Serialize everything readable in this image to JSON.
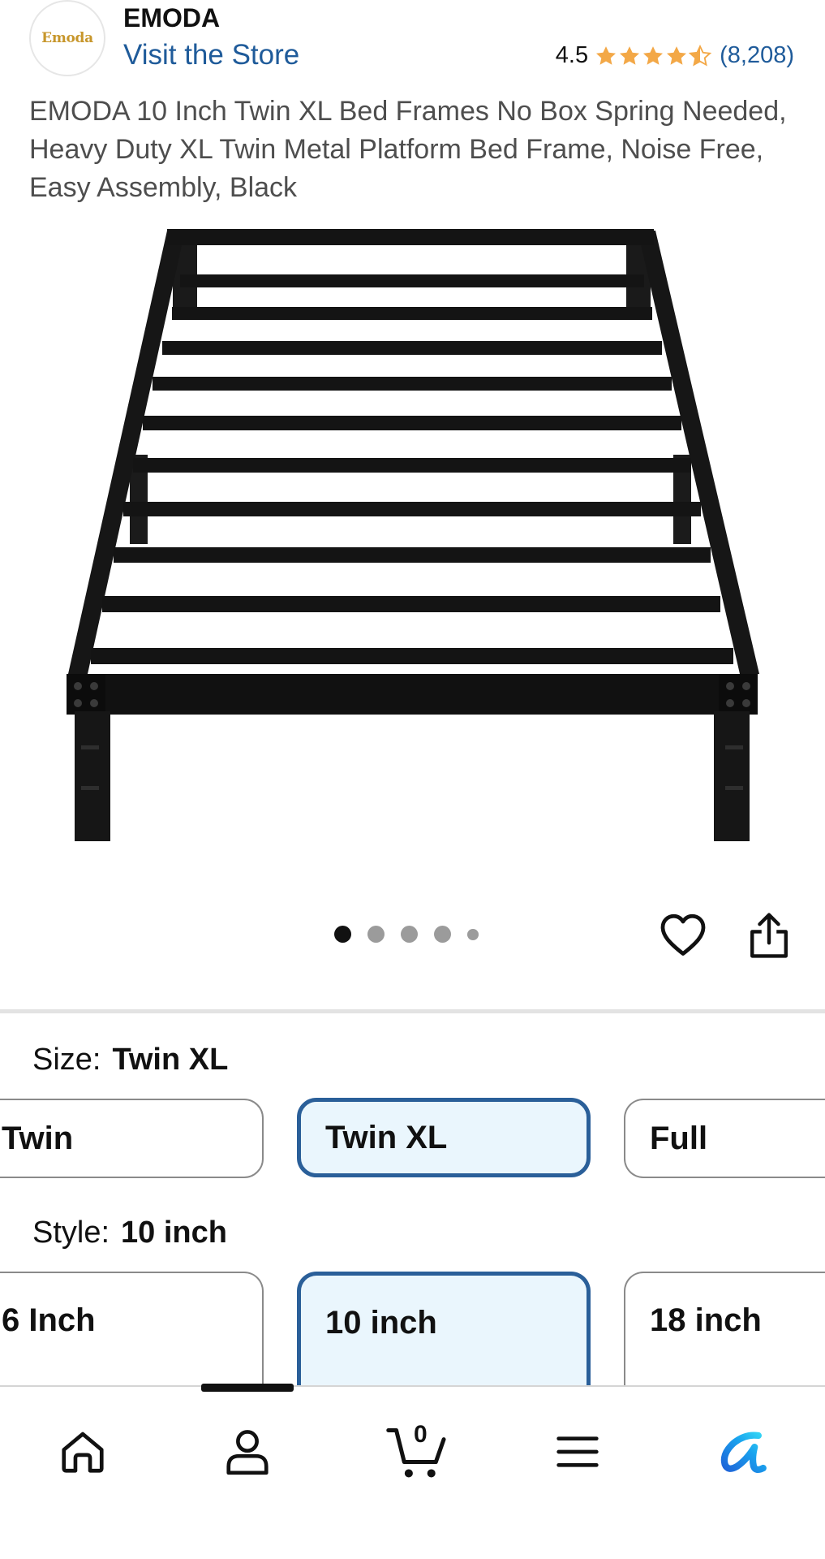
{
  "store": {
    "logo_text": "Emoda",
    "brand_name": "EMODA",
    "visit_store_label": "Visit the Store"
  },
  "rating": {
    "value": "4.5",
    "stars": 4.5,
    "count": "(8,208)",
    "star_color": "#f3a847"
  },
  "product": {
    "title": "EMODA 10 Inch Twin XL Bed Frames No Box Spring Needed, Heavy Duty XL Twin Metal Platform Bed Frame, Noise Free, Easy Assembly, Black"
  },
  "carousel": {
    "total_dots": 5,
    "active_index": 0
  },
  "size": {
    "label": "Size:",
    "selected": "Twin XL",
    "options": [
      "Twin",
      "Twin XL",
      "Full"
    ]
  },
  "style": {
    "label": "Style:",
    "selected": "10 inch",
    "options": [
      "6 Inch",
      "10 inch",
      "18 inch"
    ]
  },
  "bottom_nav": {
    "items": [
      "home-icon",
      "account-icon",
      "cart-icon",
      "menu-icon",
      "rufus-ai-icon"
    ],
    "cart_count": "0"
  },
  "colors": {
    "link": "#1f5b9a",
    "selected_border": "#2a5f99",
    "selected_fill": "#eaf6fd"
  }
}
